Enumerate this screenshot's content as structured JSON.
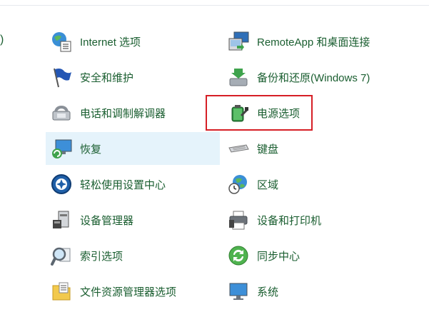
{
  "edge_text": ")",
  "colors": {
    "link": "#1a5e30",
    "hover_bg": "#e5f3fb",
    "highlight_border": "#d61f26"
  },
  "items_col1": [
    {
      "label": "Internet 选项",
      "icon": "globe-list-icon"
    },
    {
      "label": "安全和维护",
      "icon": "flag-icon"
    },
    {
      "label": "电话和调制解调器",
      "icon": "phone-modem-icon"
    },
    {
      "label": "恢复",
      "icon": "recovery-monitor-icon"
    },
    {
      "label": "轻松使用设置中心",
      "icon": "ease-of-access-icon"
    },
    {
      "label": "设备管理器",
      "icon": "device-manager-icon"
    },
    {
      "label": "索引选项",
      "icon": "magnifier-icon"
    },
    {
      "label": "文件资源管理器选项",
      "icon": "folder-options-icon"
    }
  ],
  "items_col2": [
    {
      "label": "RemoteApp 和桌面连接",
      "icon": "remote-desktop-icon"
    },
    {
      "label": "备份和还原(Windows 7)",
      "icon": "backup-restore-icon"
    },
    {
      "label": "电源选项",
      "icon": "battery-plug-icon"
    },
    {
      "label": "键盘",
      "icon": "keyboard-icon"
    },
    {
      "label": "区域",
      "icon": "globe-clock-icon"
    },
    {
      "label": "设备和打印机",
      "icon": "printer-icon"
    },
    {
      "label": "同步中心",
      "icon": "sync-icon"
    },
    {
      "label": "系统",
      "icon": "system-monitor-icon"
    }
  ]
}
